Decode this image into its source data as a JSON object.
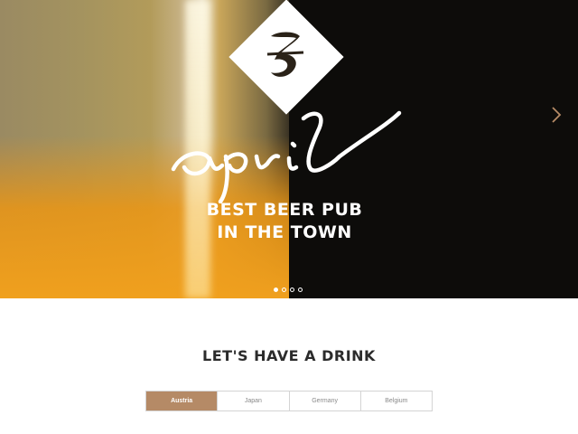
{
  "hero": {
    "script_title": "april",
    "tagline_line1": "BEST BEER PUB",
    "tagline_line2": "IN THE TOWN",
    "slide_count": 4,
    "active_slide": 1
  },
  "section": {
    "title": "LET'S HAVE A DRINK"
  },
  "tabs": [
    {
      "label": "Austria",
      "active": true
    },
    {
      "label": "Japan",
      "active": false
    },
    {
      "label": "Germany",
      "active": false
    },
    {
      "label": "Belgium",
      "active": false
    }
  ],
  "colors": {
    "accent": "#b58a66",
    "heading": "#2b2b2b",
    "tab_border": "#d4d4d4"
  },
  "icons": {
    "logo": "brand-logo-icon",
    "next": "chevron-right-icon"
  }
}
